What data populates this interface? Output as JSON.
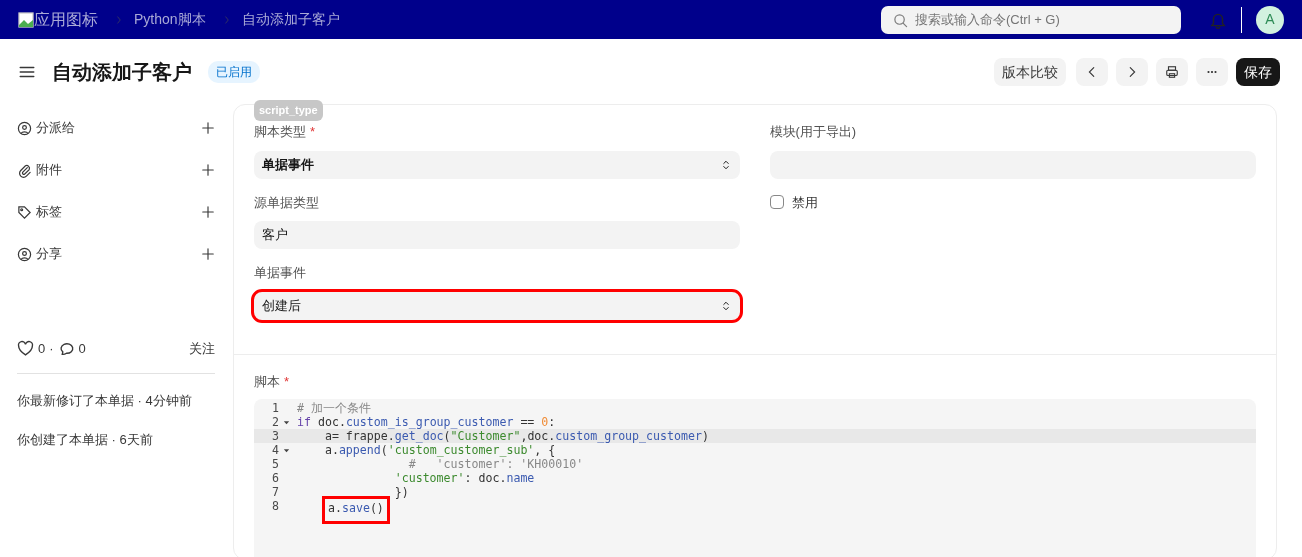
{
  "navbar": {
    "logo_alt": "应用图标",
    "breadcrumbs": [
      "Python脚本",
      "自动添加子客户"
    ],
    "search": {
      "placeholder": "搜索或输入命令(Ctrl + G)"
    },
    "avatar": "A"
  },
  "header": {
    "title": "自动添加子客户",
    "status": "已启用",
    "buttons": [
      {
        "kind": "text",
        "label": "版本比较"
      },
      {
        "kind": "prev"
      },
      {
        "kind": "next"
      },
      {
        "kind": "print"
      },
      {
        "kind": "more"
      },
      {
        "kind": "primary",
        "label": "保存"
      }
    ]
  },
  "sidebar": {
    "actions": [
      {
        "kind": "assign",
        "label": "分派给"
      },
      {
        "kind": "attach",
        "label": "附件"
      },
      {
        "kind": "tag",
        "label": "标签"
      },
      {
        "kind": "share",
        "label": "分享"
      }
    ],
    "likes": "0",
    "separator": "·",
    "comments": "0",
    "follow": "关注",
    "activity": [
      "你最新修订了本单据 · 4分钟前",
      "你创建了本单据 · 6天前"
    ]
  },
  "form": {
    "tooltip": "script_type",
    "left_fields": [
      {
        "kind": "select",
        "label": "脚本类型",
        "required_mark": "*",
        "value": "单据事件",
        "bold": true,
        "annotated": false
      },
      {
        "kind": "text",
        "label": "源单据类型",
        "value": "客户",
        "bold": false,
        "annotated": false
      },
      {
        "kind": "select",
        "label": "单据事件",
        "value": "创建后",
        "bold": false,
        "annotated": true
      }
    ],
    "right_fields": [
      {
        "kind": "text",
        "label": "模块(用于导出)"
      },
      {
        "kind": "check",
        "label": "禁用",
        "checked": false
      }
    ],
    "script": {
      "label": "脚本",
      "required_mark": "*",
      "lines": [
        {
          "number": "1",
          "selected": false,
          "annotated": false,
          "tokens": [
            {
              "kind": "comment",
              "text": "# 加一个条件"
            }
          ]
        },
        {
          "number": "2",
          "expanded": true,
          "selected": false,
          "annotated": false,
          "tokens": [
            {
              "kind": "keyword",
              "text": "if"
            },
            {
              "kind": "plain",
              "text": " doc."
            },
            {
              "kind": "name",
              "text": "custom_is_group_customer"
            },
            {
              "kind": "plain",
              "text": " == "
            },
            {
              "kind": "number",
              "text": "0"
            },
            {
              "kind": "plain",
              "text": ":"
            }
          ]
        },
        {
          "number": "3",
          "selected": true,
          "annotated": false,
          "tokens": [
            {
              "kind": "plain",
              "text": "    a= frappe."
            },
            {
              "kind": "name",
              "text": "get_doc"
            },
            {
              "kind": "plain",
              "text": "("
            },
            {
              "kind": "string",
              "text": "\"Customer\""
            },
            {
              "kind": "plain",
              "text": ",doc."
            },
            {
              "kind": "name",
              "text": "custom_group_customer"
            },
            {
              "kind": "plain",
              "text": ")"
            }
          ]
        },
        {
          "number": "4",
          "expanded": true,
          "selected": false,
          "annotated": false,
          "tokens": [
            {
              "kind": "plain",
              "text": "    a."
            },
            {
              "kind": "name",
              "text": "append"
            },
            {
              "kind": "plain",
              "text": "("
            },
            {
              "kind": "string",
              "text": "'custom_customer_sub'"
            },
            {
              "kind": "plain",
              "text": ", {"
            }
          ]
        },
        {
          "number": "5",
          "selected": false,
          "annotated": false,
          "tokens": [
            {
              "kind": "comment",
              "text": "                #   'customer': 'KH00010'"
            }
          ]
        },
        {
          "number": "6",
          "selected": false,
          "annotated": false,
          "tokens": [
            {
              "kind": "string",
              "text": "              'customer'"
            },
            {
              "kind": "plain",
              "text": ": doc."
            },
            {
              "kind": "name",
              "text": "name"
            }
          ]
        },
        {
          "number": "7",
          "selected": false,
          "annotated": false,
          "tokens": [
            {
              "kind": "plain",
              "text": "              })"
            }
          ]
        },
        {
          "number": "8",
          "selected": false,
          "annotated": true,
          "tokens": [
            {
              "kind": "plain",
              "text": "    a."
            },
            {
              "kind": "name",
              "text": "save"
            },
            {
              "kind": "plain",
              "text": "()"
            }
          ]
        }
      ]
    }
  }
}
